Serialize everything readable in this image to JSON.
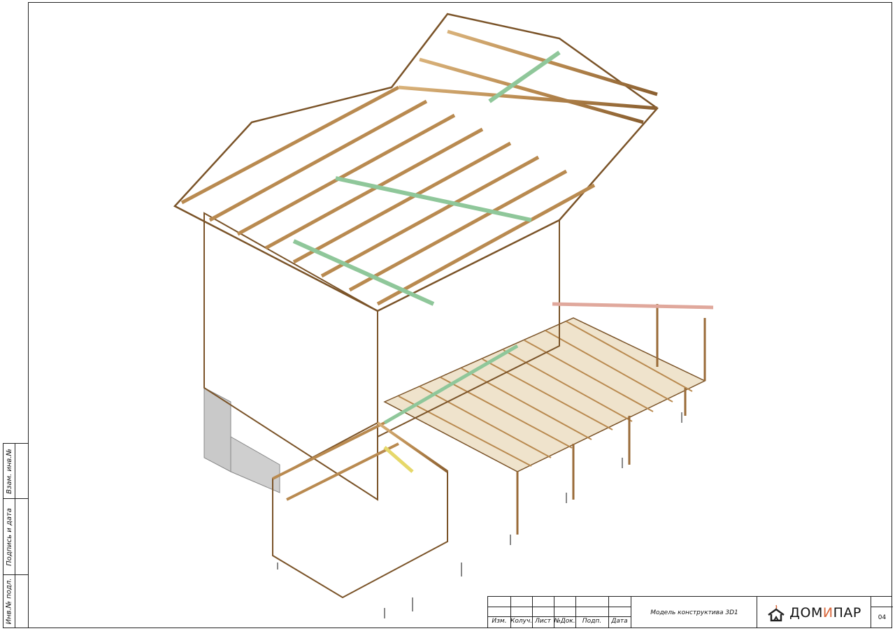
{
  "side_stamp": {
    "col1": "Взам. инв.№",
    "col2": "Подпись и дата",
    "col3": "Инв.№ подл."
  },
  "title_block": {
    "columns": [
      "Изм.",
      "Колуч.",
      "Лист",
      "№Док.",
      "Подп.",
      "Дата"
    ],
    "drawing_title": "Модель конструктива 3D1",
    "logo": {
      "left": "ДОМ",
      "mid": "И",
      "right": "ПАР"
    },
    "sheet_number": "04"
  },
  "colors": {
    "timber": "#b98a50",
    "timber_dark": "#7a5328",
    "timber_light": "#d9b27a",
    "green_beam": "#8fc79a",
    "pink_beam": "#e0a89c",
    "logo_accent": "#d8663a"
  },
  "drawing": {
    "icon": "timber-frame-house-3d-model"
  }
}
